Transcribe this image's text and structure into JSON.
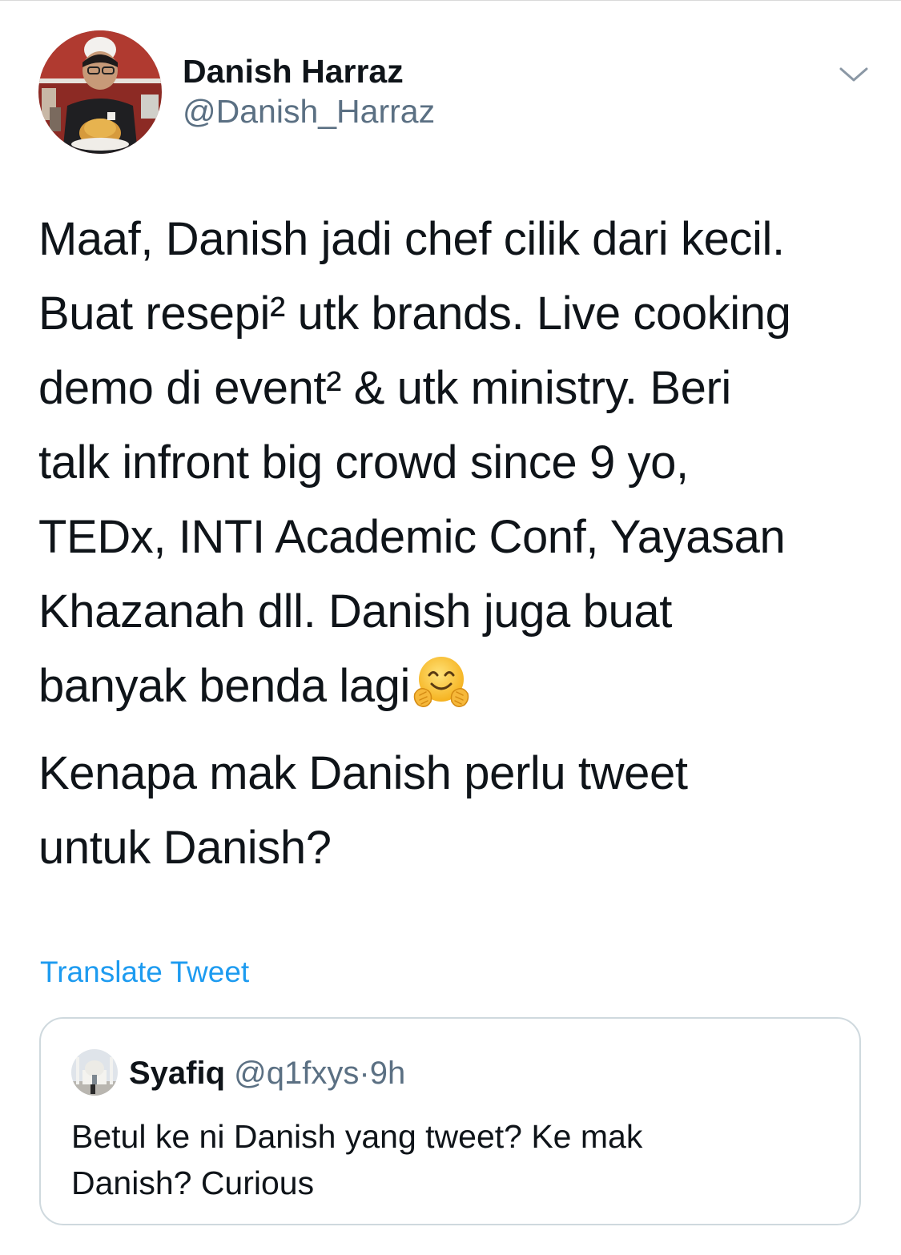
{
  "author": {
    "display_name": "Danish Harraz",
    "handle": "@Danish_Harraz",
    "avatar_icon": "profile-photo-chef"
  },
  "tweet": {
    "paragraph1_lines": [
      "Maaf, Danish jadi chef cilik dari kecil.",
      "Buat resepi² utk brands. Live cooking",
      "demo di event² & utk ministry. Beri",
      "talk infront big crowd since 9 yo,",
      "TEDx, INTI Academic Conf, Yayasan",
      "Khazanah dll. Danish juga buat",
      "banyak benda lagi"
    ],
    "paragraph1_emoji": "hugging-face-emoji",
    "paragraph2_lines": [
      "Kenapa mak Danish perlu tweet",
      "untuk Danish?"
    ]
  },
  "translate_label": "Translate Tweet",
  "quoted_tweet": {
    "display_name": "Syafiq",
    "handle": "@q1fxys",
    "separator": "·",
    "time": "9h",
    "text_lines": [
      "Betul ke ni Danish yang tweet? Ke mak",
      "Danish? Curious"
    ],
    "avatar_icon": "mosque-photo"
  },
  "colors": {
    "link": "#1d9bf0",
    "secondary_text": "#5b7083",
    "border": "#cfd9de"
  }
}
